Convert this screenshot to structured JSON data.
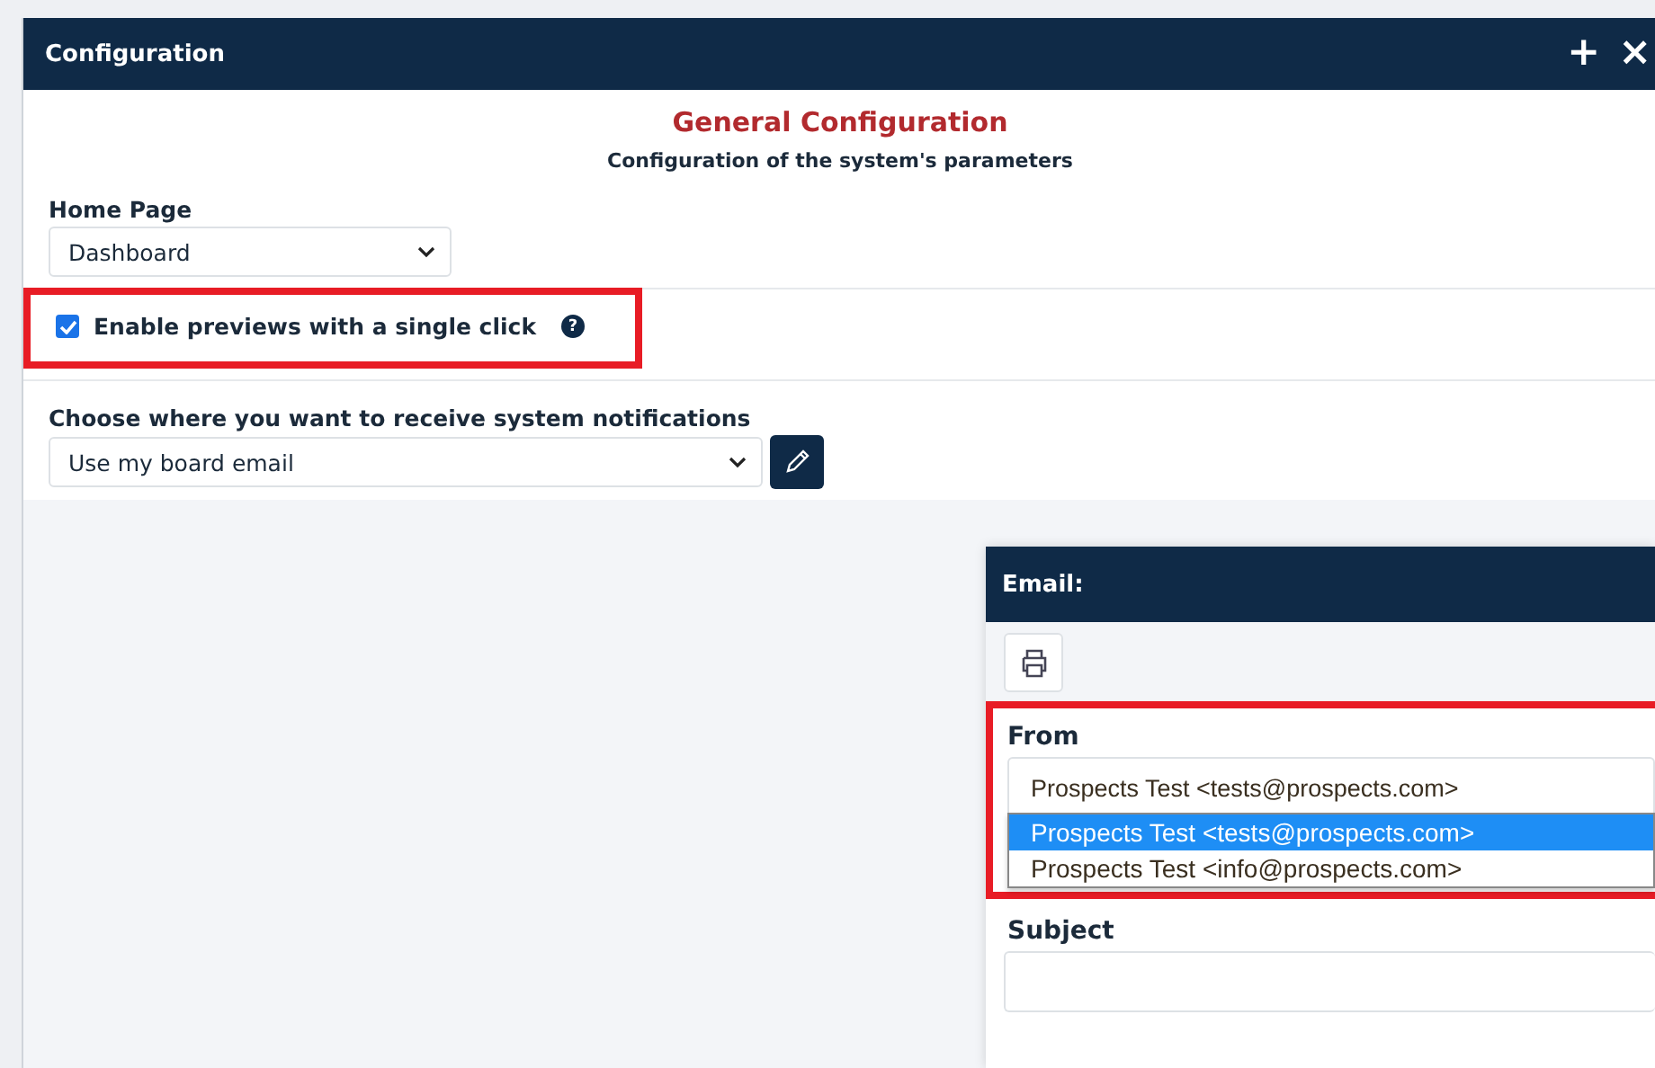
{
  "window": {
    "title": "Configuration",
    "actions": [
      "+",
      "×"
    ]
  },
  "heading": "General Configuration",
  "subheading": "Configuration of the system's parameters",
  "home_page": {
    "label": "Home Page",
    "value": "Dashboard"
  },
  "preview_option": {
    "label": "Enable previews with a single click",
    "checked": true,
    "highlighted": true,
    "help": "?"
  },
  "notifications": {
    "label": "Choose where you want to receive system notifications",
    "value": "Use my board email"
  },
  "email_dialog": {
    "title": "Email:",
    "from": {
      "label": "From",
      "value": "Prospects Test <tests@prospects.com>",
      "highlighted": true,
      "options": [
        {
          "label": "Prospects Test <tests@prospects.com>",
          "selected": true
        },
        {
          "label": "Prospects Test <info@prospects.com>",
          "selected": false
        }
      ]
    },
    "subject": {
      "label": "Subject"
    }
  }
}
